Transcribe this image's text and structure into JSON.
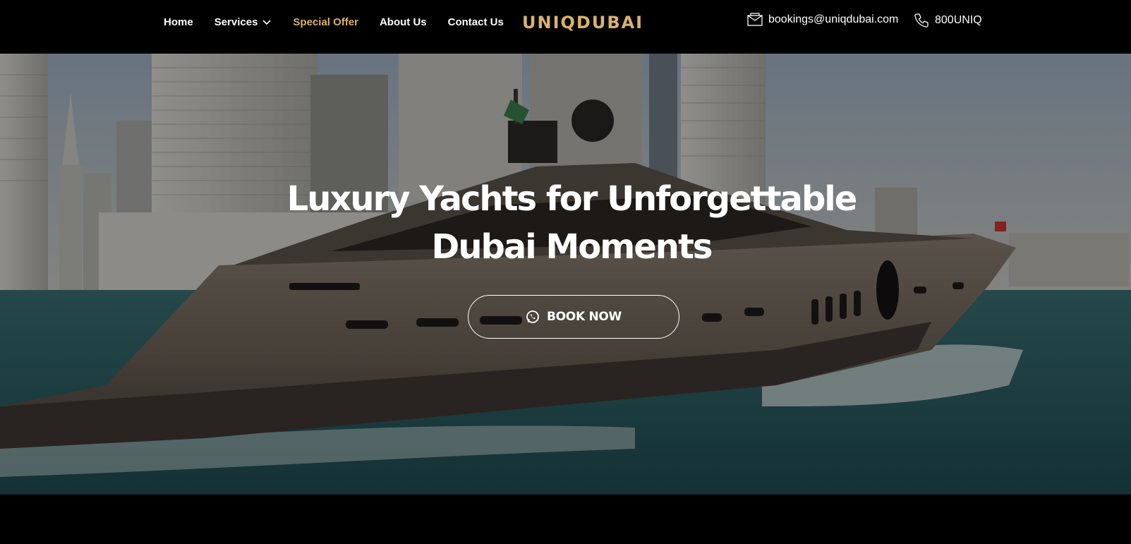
{
  "header": {
    "nav": [
      {
        "label": "Home"
      },
      {
        "label": "Services"
      },
      {
        "label": "Special Offer"
      },
      {
        "label": "About Us"
      },
      {
        "label": "Contact Us"
      }
    ],
    "logo_text": "UNIQDUBAI",
    "email": "bookings@uniqdubai.com",
    "phone": "800UNIQ",
    "icons": {
      "services_dropdown": "chevron-down-icon",
      "email": "envelope-icon",
      "phone": "phone-icon"
    }
  },
  "hero": {
    "headline_line1": "Luxury Yachts for Unforgettable",
    "headline_line2": "Dubai Moments",
    "cta_label": "BOOK NOW",
    "cta_icon": "whatsapp-icon",
    "background": "yacht-cruising-dubai-marina"
  },
  "colors": {
    "accent_gold": "#d9b26f",
    "header_bg": "#000000",
    "text": "#ffffff"
  }
}
